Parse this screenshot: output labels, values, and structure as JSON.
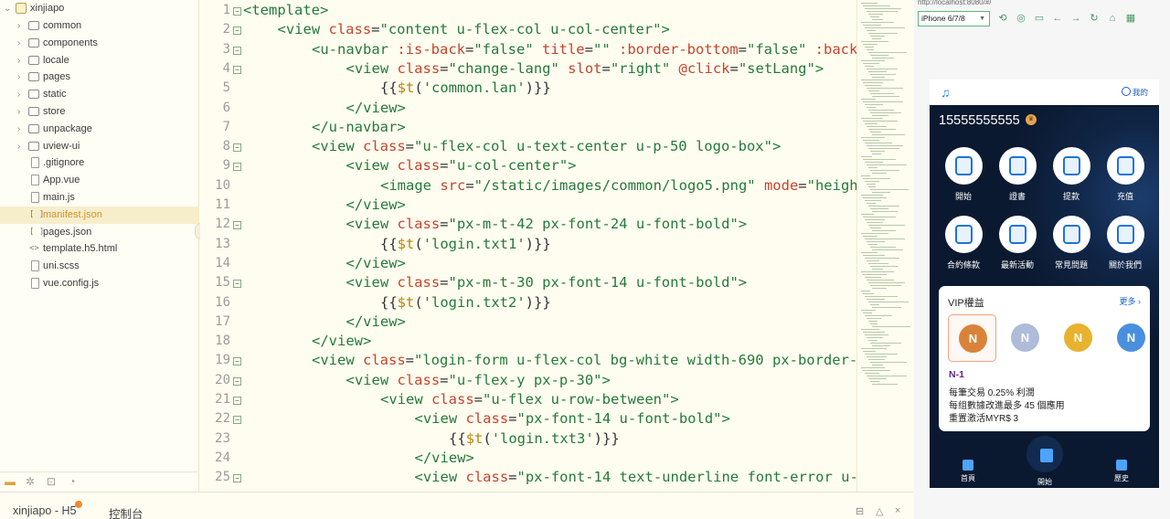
{
  "explorer": {
    "root": "xinjiapo",
    "items": [
      {
        "label": "common",
        "kind": "folder"
      },
      {
        "label": "components",
        "kind": "folder"
      },
      {
        "label": "locale",
        "kind": "folder"
      },
      {
        "label": "pages",
        "kind": "folder"
      },
      {
        "label": "static",
        "kind": "folder"
      },
      {
        "label": "store",
        "kind": "folder"
      },
      {
        "label": "unpackage",
        "kind": "folder"
      },
      {
        "label": "uview-ui",
        "kind": "folder"
      },
      {
        "label": ".gitignore",
        "kind": "file"
      },
      {
        "label": "App.vue",
        "kind": "file"
      },
      {
        "label": "main.js",
        "kind": "file"
      },
      {
        "label": "manifest.json",
        "kind": "json",
        "selected": true
      },
      {
        "label": "pages.json",
        "kind": "json"
      },
      {
        "label": "template.h5.html",
        "kind": "html"
      },
      {
        "label": "uni.scss",
        "kind": "file"
      },
      {
        "label": "vue.config.js",
        "kind": "file"
      }
    ]
  },
  "editor": {
    "lines": [
      {
        "n": "1",
        "fold": true,
        "indent": 0,
        "parts": [
          [
            "tag",
            "<template>"
          ]
        ]
      },
      {
        "n": "2",
        "fold": true,
        "indent": 1,
        "parts": [
          [
            "tag",
            "<view "
          ],
          [
            "attr",
            "class"
          ],
          [
            "expr",
            "="
          ],
          [
            "str",
            "\"content u-flex-col u-col-center\""
          ],
          [
            "tag",
            ">"
          ]
        ]
      },
      {
        "n": "3",
        "fold": true,
        "indent": 2,
        "parts": [
          [
            "tag",
            "<u-navbar "
          ],
          [
            "attr",
            ":is-back"
          ],
          [
            "expr",
            "="
          ],
          [
            "str",
            "\"false\" "
          ],
          [
            "attr",
            "title"
          ],
          [
            "expr",
            "="
          ],
          [
            "str",
            "\"\" "
          ],
          [
            "attr",
            ":border-bottom"
          ],
          [
            "expr",
            "="
          ],
          [
            "str",
            "\"false\" "
          ],
          [
            "attr",
            ":back"
          ]
        ]
      },
      {
        "n": "4",
        "fold": true,
        "indent": 3,
        "parts": [
          [
            "tag",
            "<view "
          ],
          [
            "attr",
            "class"
          ],
          [
            "expr",
            "="
          ],
          [
            "str",
            "\"change-lang\" "
          ],
          [
            "attr",
            "slot"
          ],
          [
            "expr",
            "="
          ],
          [
            "str",
            "\"right\" "
          ],
          [
            "attr",
            "@click"
          ],
          [
            "expr",
            "="
          ],
          [
            "str",
            "\"setLang\""
          ],
          [
            "tag",
            ">"
          ]
        ]
      },
      {
        "n": "5",
        "fold": false,
        "indent": 4,
        "parts": [
          [
            "expr",
            "{{"
          ],
          [
            "fn",
            "$t"
          ],
          [
            "expr",
            "("
          ],
          [
            "str",
            "'common.lan'"
          ],
          [
            "expr",
            ")}}"
          ]
        ]
      },
      {
        "n": "6",
        "fold": false,
        "indent": 3,
        "parts": [
          [
            "tag",
            "</view>"
          ]
        ]
      },
      {
        "n": "7",
        "fold": false,
        "indent": 2,
        "parts": [
          [
            "tag",
            "</u-navbar>"
          ]
        ]
      },
      {
        "n": "8",
        "fold": true,
        "indent": 2,
        "parts": [
          [
            "tag",
            "<view "
          ],
          [
            "attr",
            "class"
          ],
          [
            "expr",
            "="
          ],
          [
            "str",
            "\"u-flex-col u-text-center u-p-50 logo-box\""
          ],
          [
            "tag",
            ">"
          ]
        ]
      },
      {
        "n": "9",
        "fold": true,
        "indent": 3,
        "parts": [
          [
            "tag",
            "<view "
          ],
          [
            "attr",
            "class"
          ],
          [
            "expr",
            "="
          ],
          [
            "str",
            "\"u-col-center\""
          ],
          [
            "tag",
            ">"
          ]
        ]
      },
      {
        "n": "10",
        "fold": false,
        "indent": 4,
        "parts": [
          [
            "tag",
            "<image "
          ],
          [
            "attr",
            "src"
          ],
          [
            "expr",
            "="
          ],
          [
            "str",
            "\"/static/images/common/logo5.png\" "
          ],
          [
            "attr",
            "mode"
          ],
          [
            "expr",
            "="
          ],
          [
            "str",
            "\"heigh"
          ]
        ]
      },
      {
        "n": "11",
        "fold": false,
        "indent": 3,
        "parts": [
          [
            "tag",
            "</view>"
          ]
        ]
      },
      {
        "n": "12",
        "fold": true,
        "indent": 3,
        "parts": [
          [
            "tag",
            "<view "
          ],
          [
            "attr",
            "class"
          ],
          [
            "expr",
            "="
          ],
          [
            "str",
            "\"px-m-t-42 px-font-24 u-font-bold\""
          ],
          [
            "tag",
            ">"
          ]
        ]
      },
      {
        "n": "13",
        "fold": false,
        "indent": 4,
        "parts": [
          [
            "expr",
            "{{"
          ],
          [
            "fn",
            "$t"
          ],
          [
            "expr",
            "("
          ],
          [
            "str",
            "'login.txt1'"
          ],
          [
            "expr",
            ")}}"
          ]
        ]
      },
      {
        "n": "14",
        "fold": false,
        "indent": 3,
        "parts": [
          [
            "tag",
            "</view>"
          ]
        ]
      },
      {
        "n": "15",
        "fold": true,
        "indent": 3,
        "parts": [
          [
            "tag",
            "<view "
          ],
          [
            "attr",
            "class"
          ],
          [
            "expr",
            "="
          ],
          [
            "str",
            "\"px-m-t-30 px-font-14 u-font-bold\""
          ],
          [
            "tag",
            ">"
          ]
        ]
      },
      {
        "n": "16",
        "fold": false,
        "indent": 4,
        "parts": [
          [
            "expr",
            "{{"
          ],
          [
            "fn",
            "$t"
          ],
          [
            "expr",
            "("
          ],
          [
            "str",
            "'login.txt2'"
          ],
          [
            "expr",
            ")}}"
          ]
        ]
      },
      {
        "n": "17",
        "fold": false,
        "indent": 3,
        "parts": [
          [
            "tag",
            "</view>"
          ]
        ]
      },
      {
        "n": "18",
        "fold": false,
        "indent": 2,
        "parts": [
          [
            "tag",
            "</view>"
          ]
        ]
      },
      {
        "n": "19",
        "fold": true,
        "indent": 2,
        "parts": [
          [
            "tag",
            "<view "
          ],
          [
            "attr",
            "class"
          ],
          [
            "expr",
            "="
          ],
          [
            "str",
            "\"login-form u-flex-col bg-white width-690 px-border-"
          ]
        ]
      },
      {
        "n": "20",
        "fold": true,
        "indent": 3,
        "parts": [
          [
            "tag",
            "<view "
          ],
          [
            "attr",
            "class"
          ],
          [
            "expr",
            "="
          ],
          [
            "str",
            "\"u-flex-y px-p-30\""
          ],
          [
            "tag",
            ">"
          ]
        ]
      },
      {
        "n": "21",
        "fold": true,
        "indent": 4,
        "parts": [
          [
            "tag",
            "<view "
          ],
          [
            "attr",
            "class"
          ],
          [
            "expr",
            "="
          ],
          [
            "str",
            "\"u-flex u-row-between\""
          ],
          [
            "tag",
            ">"
          ]
        ]
      },
      {
        "n": "22",
        "fold": true,
        "indent": 5,
        "parts": [
          [
            "tag",
            "<view "
          ],
          [
            "attr",
            "class"
          ],
          [
            "expr",
            "="
          ],
          [
            "str",
            "\"px-font-14 u-font-bold\""
          ],
          [
            "tag",
            ">"
          ]
        ]
      },
      {
        "n": "23",
        "fold": false,
        "indent": 6,
        "parts": [
          [
            "expr",
            "{{"
          ],
          [
            "fn",
            "$t"
          ],
          [
            "expr",
            "("
          ],
          [
            "str",
            "'login.txt3'"
          ],
          [
            "expr",
            ")}}"
          ]
        ]
      },
      {
        "n": "24",
        "fold": false,
        "indent": 5,
        "parts": [
          [
            "tag",
            "</view>"
          ]
        ]
      },
      {
        "n": "25",
        "fold": true,
        "indent": 5,
        "parts": [
          [
            "tag",
            "<view "
          ],
          [
            "attr",
            "class"
          ],
          [
            "expr",
            "="
          ],
          [
            "str",
            "\"px-font-14 text-underline font-error u-"
          ]
        ]
      }
    ]
  },
  "bottom": {
    "tab1": "xinjiapo - H5",
    "tab2": "控制台"
  },
  "preview": {
    "url": "http://localhost:8080/#/",
    "device": "iPhone 6/7/8",
    "app": {
      "mine_label": "我的",
      "phone_number": "15555555555",
      "grid": [
        "開始",
        "證書",
        "提款",
        "充值",
        "合約條款",
        "最新活動",
        "常見問題",
        "關於我們"
      ],
      "vip": {
        "title": "VIP權益",
        "more": "更多",
        "medal_letter": "N",
        "level": "N-1",
        "line1": "每筆交易 0.25% 利潤",
        "line2": "每组數據改進最多 45 個應用",
        "line3": "重置激活MYR$ 3"
      },
      "tabs": [
        "首頁",
        "開始",
        "歷史"
      ]
    }
  },
  "colors": {
    "accent_green": "#247a3a",
    "attr_red": "#c4452c",
    "selected_file": "#d4922a",
    "app_navy": "#0b1930",
    "app_blue": "#1a5fc7"
  }
}
